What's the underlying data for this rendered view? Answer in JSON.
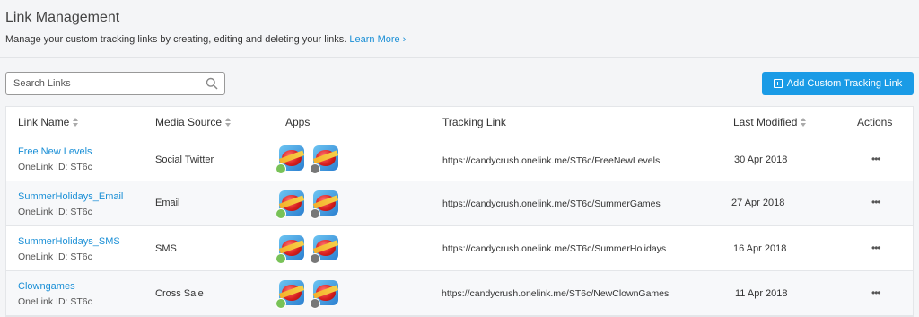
{
  "header": {
    "title": "Link Management",
    "subtitle": "Manage your custom tracking links by creating, editing and deleting your links.",
    "learn_more": "Learn More ›"
  },
  "search": {
    "placeholder": "Search Links"
  },
  "add_button": {
    "label": "Add Custom Tracking Link"
  },
  "table": {
    "columns": {
      "link_name": "Link Name",
      "media_source": "Media Source",
      "apps": "Apps",
      "tracking_link": "Tracking Link",
      "last_modified": "Last Modified",
      "actions": "Actions"
    },
    "rows": [
      {
        "name": "Free New Levels",
        "onelink": "OneLink ID: ST6c",
        "media": "Social Twitter",
        "url": "https://candycrush.onelink.me/ST6c/FreeNewLevels",
        "date": "30 Apr 2018",
        "actions": "•••"
      },
      {
        "name": "SummerHolidays_Email",
        "onelink": "OneLink ID: ST6c",
        "media": "Email",
        "url": "https://candycrush.onelink.me/ST6c/SummerGames",
        "date": "27 Apr 2018",
        "actions": "•••"
      },
      {
        "name": "SummerHolidays_SMS",
        "onelink": "OneLink ID: ST6c",
        "media": "SMS",
        "url": "https://candycrush.onelink.me/ST6c/SummerHolidays",
        "date": "16 Apr 2018",
        "actions": "•••"
      },
      {
        "name": "Clowngames",
        "onelink": "OneLink ID: ST6c",
        "media": "Cross Sale",
        "url": "https://candycrush.onelink.me/ST6c/NewClownGames",
        "date": "11 Apr 2018",
        "actions": "•••"
      }
    ]
  },
  "icons": {
    "search": "search-icon",
    "add": "plus-square-icon",
    "android": "android-badge-icon",
    "apple": "apple-badge-icon"
  },
  "colors": {
    "accent": "#1a9be6",
    "link": "#1a8fd6"
  }
}
